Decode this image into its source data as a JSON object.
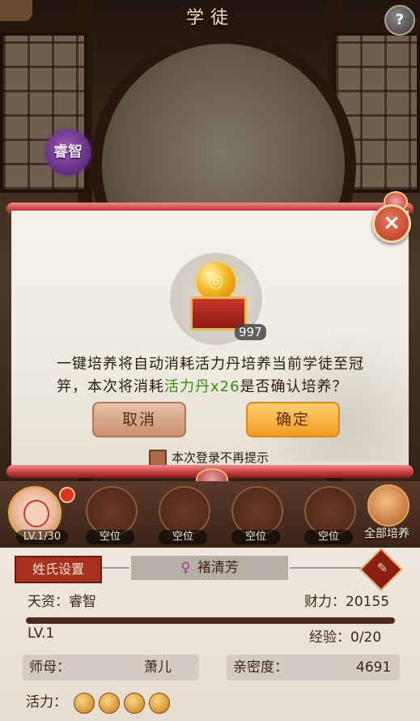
{
  "header": {
    "title": "学徒",
    "help_label": "?"
  },
  "trait_badge": "睿智",
  "dialog": {
    "close_label": "×",
    "item_count": "997",
    "message_part1": "一键培养将自动消耗活力丹培养当前学徒至冠笄，本次将消耗",
    "message_highlight": "活力丹x26",
    "message_part2": "是否确认培养？",
    "cancel_label": "取消",
    "confirm_label": "确定",
    "checkbox_label": "本次登录不再提示"
  },
  "slots": {
    "level": "LV.1/30",
    "empty_label": "空位",
    "all_train_label": "全部培养"
  },
  "info": {
    "surname_button": "姓氏设置",
    "gender_symbol": "♀",
    "name": "褚清芳",
    "aptitude_label": "天资：",
    "aptitude_value": "睿智",
    "wealth_label": "财力：",
    "wealth_value": "20155",
    "level": "LV.1",
    "exp_label": "经验：",
    "exp_value": "0/20",
    "exp_progress": 0,
    "mentor_label": "师母：",
    "mentor_value": "萧儿",
    "intimacy_label": "亲密度：",
    "intimacy_value": "4691",
    "stamina_label": "活力：",
    "stamina_count": 4
  },
  "colors": {
    "highlight": "#3a8a1a",
    "rod": "#c23a3a",
    "confirm": "#f29a20"
  }
}
